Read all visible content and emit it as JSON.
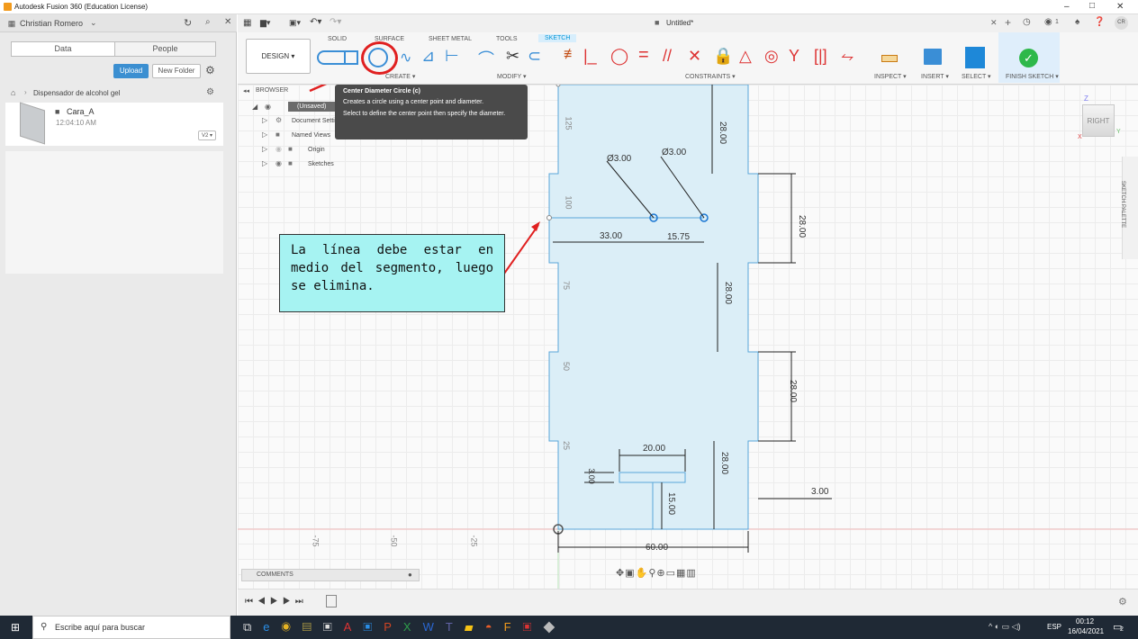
{
  "window": {
    "title": "Autodesk Fusion 360 (Education License)",
    "doc_title": "Untitled*",
    "min": "–",
    "max": "□",
    "close": "✕"
  },
  "user": {
    "name": "Christian Romero",
    "initials": "CR",
    "count": "1"
  },
  "data_panel": {
    "tab_data": "Data",
    "tab_people": "People",
    "upload": "Upload",
    "new_folder": "New Folder",
    "project": "Dispensador de alcohol gel",
    "item_name": "Cara_A",
    "item_time": "12:04:10 AM",
    "item_version": "V2 ▾"
  },
  "toolbar": {
    "design": "DESIGN ▾",
    "tabs": [
      "SOLID",
      "SURFACE",
      "SHEET METAL",
      "TOOLS",
      "SKETCH"
    ],
    "groups": {
      "create": "CREATE ▾",
      "modify": "MODIFY ▾",
      "constraints": "CONSTRAINTS ▾",
      "inspect": "INSPECT ▾",
      "insert": "INSERT ▾",
      "select": "SELECT ▾",
      "finish": "FINISH SKETCH ▾"
    }
  },
  "tooltip": {
    "title": "Center Diameter Circle (c)",
    "line1": "Creates a circle using a center point and diameter.",
    "line2": "Select to define the center point then specify the diameter."
  },
  "browser": {
    "header": "BROWSER",
    "root": "(Unsaved)",
    "items": [
      "Document Settings",
      "Named Views",
      "Origin",
      "Sketches"
    ]
  },
  "annotation": {
    "text": "La línea debe estar en medio del segmento, luego se elimina."
  },
  "dimensions": {
    "d1": "Ø3.00",
    "d2": "Ø3.00",
    "d3": "33.00",
    "d4": "15.75",
    "d5": "28.00",
    "d6": "28.00",
    "d7": "28.00",
    "d8": "28.00",
    "d9": "28.00",
    "d10": "20.00",
    "d11": "3.00",
    "d12": "15.00",
    "d13": "3.00",
    "d14": "60.00"
  },
  "axis_labels": {
    "v125": "125",
    "v100": "100",
    "v75": "75",
    "v50": "50",
    "v25": "25",
    "h75": "-75",
    "h50": "-50",
    "h25": "-25"
  },
  "viewcube": {
    "face": "RIGHT",
    "z": "Z",
    "y": "Y",
    "x": "X"
  },
  "sketch_palette": "SKETCH PALETTE",
  "comments": "COMMENTS",
  "taskbar": {
    "search": "Escribe aquí para buscar",
    "lang": "ESP",
    "time": "00:12",
    "date": "16/04/2021",
    "notif": "2"
  },
  "colors": {
    "sketch_fill": "#dbeef7",
    "sketch_line": "#5aa7d9",
    "accent": "#0696d7",
    "annotation_bg": "#a6f3f2",
    "arrow": "#e02020"
  }
}
